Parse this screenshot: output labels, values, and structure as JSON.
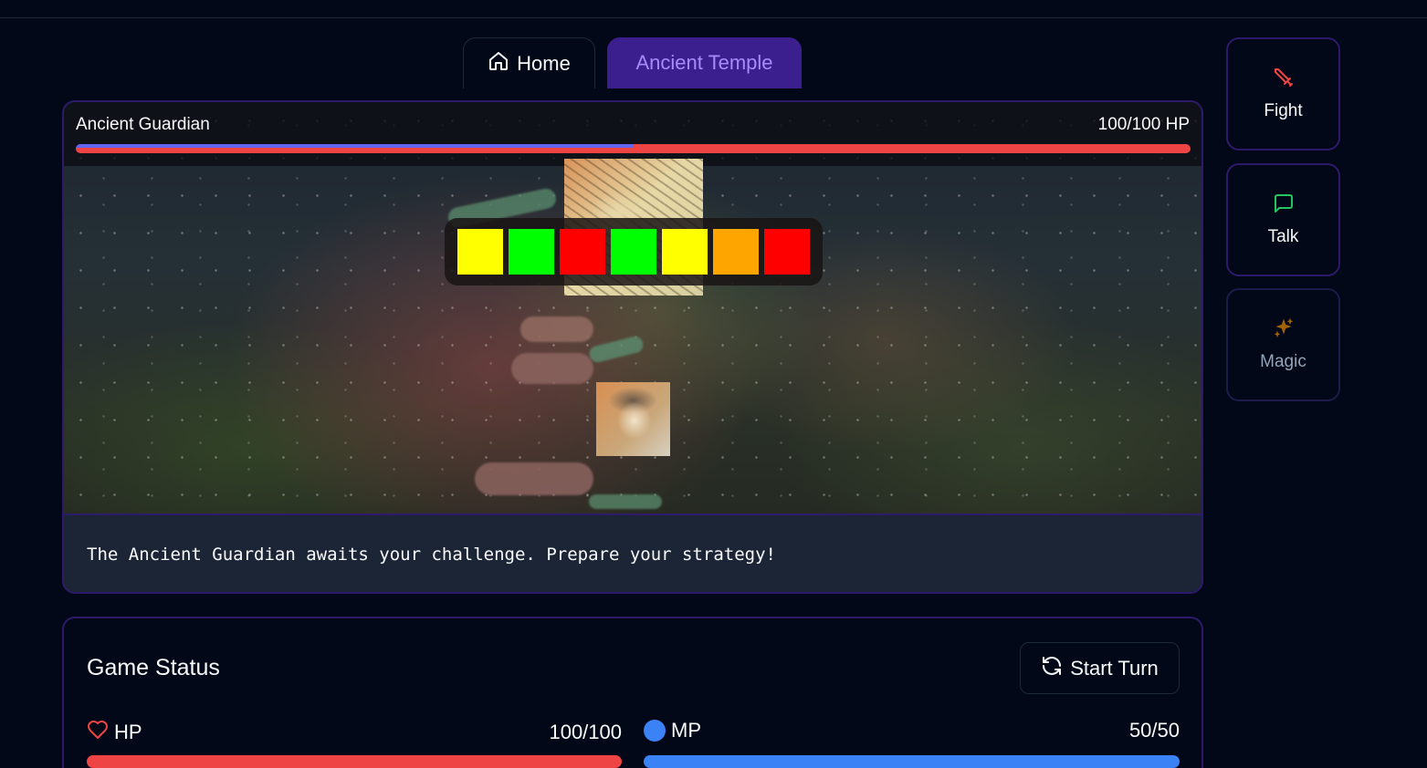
{
  "tabs": [
    {
      "label": "Home",
      "icon": "home-icon",
      "active": false
    },
    {
      "label": "Ancient Temple",
      "active": true
    }
  ],
  "enemy": {
    "name": "Ancient Guardian",
    "hp_text": "100/100 HP",
    "hp_fraction": 1.0,
    "shield_fraction": 0.5
  },
  "combo": {
    "cells": [
      "#ffff00",
      "#00ff00",
      "#ff0000",
      "#00ff00",
      "#ffff00",
      "#ffa500",
      "#ff0000"
    ]
  },
  "message": "The Ancient Guardian awaits your challenge. Prepare your strategy!",
  "actions": [
    {
      "label": "Fight",
      "icon": "sword-icon",
      "color": "#ef4444"
    },
    {
      "label": "Talk",
      "icon": "chat-icon",
      "color": "#22c55e"
    },
    {
      "label": "Magic",
      "icon": "sparkles-icon",
      "color": "#a16207"
    }
  ],
  "status": {
    "title": "Game Status",
    "start_label": "Start Turn",
    "hp_label": "HP",
    "hp_value": "100/100",
    "hp_fraction": 1.0,
    "mp_label": "MP",
    "mp_value": "50/50",
    "mp_fraction": 1.0
  },
  "colors": {
    "accent": "#3b1f8f",
    "hp": "#ef4444",
    "mp": "#3b82f6"
  }
}
